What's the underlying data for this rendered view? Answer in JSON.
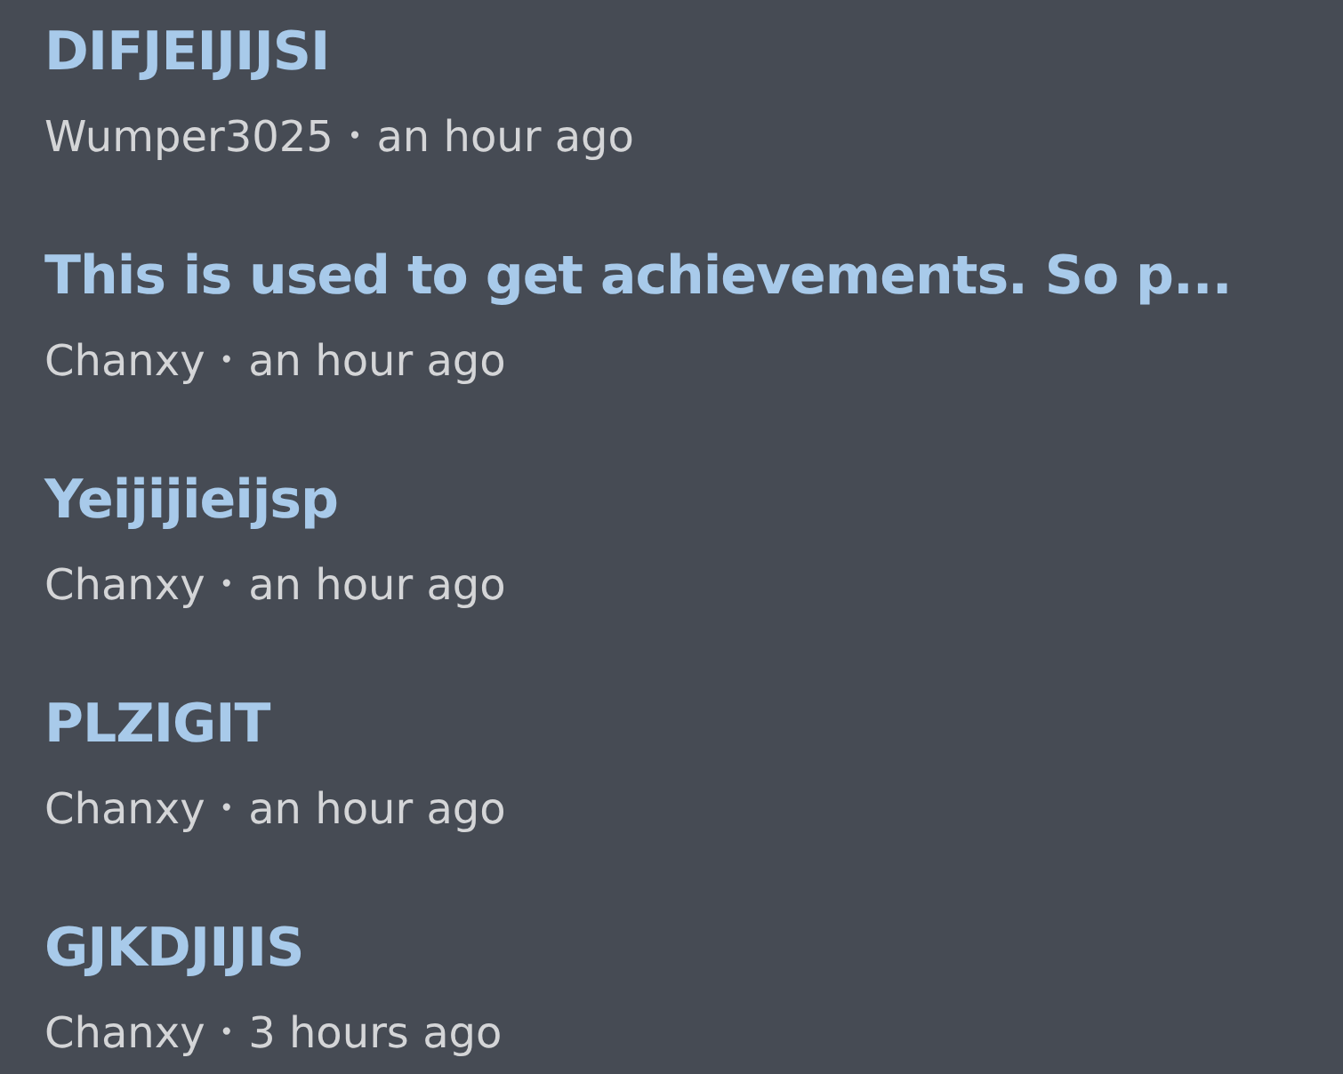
{
  "posts": [
    {
      "title": "DIFJEIJIJSI",
      "author": "Wumper3025",
      "separator": "•",
      "time": "an hour ago"
    },
    {
      "title": "This is used to get achievements. So p...",
      "author": "Chanxy",
      "separator": "•",
      "time": "an hour ago"
    },
    {
      "title": "Yeijijieijsp",
      "author": "Chanxy",
      "separator": "•",
      "time": "an hour ago"
    },
    {
      "title": "PLZIGIT",
      "author": "Chanxy",
      "separator": "•",
      "time": "an hour ago"
    },
    {
      "title": "GJKDJIJIS",
      "author": "Chanxy",
      "separator": "•",
      "time": "3 hours ago"
    }
  ]
}
